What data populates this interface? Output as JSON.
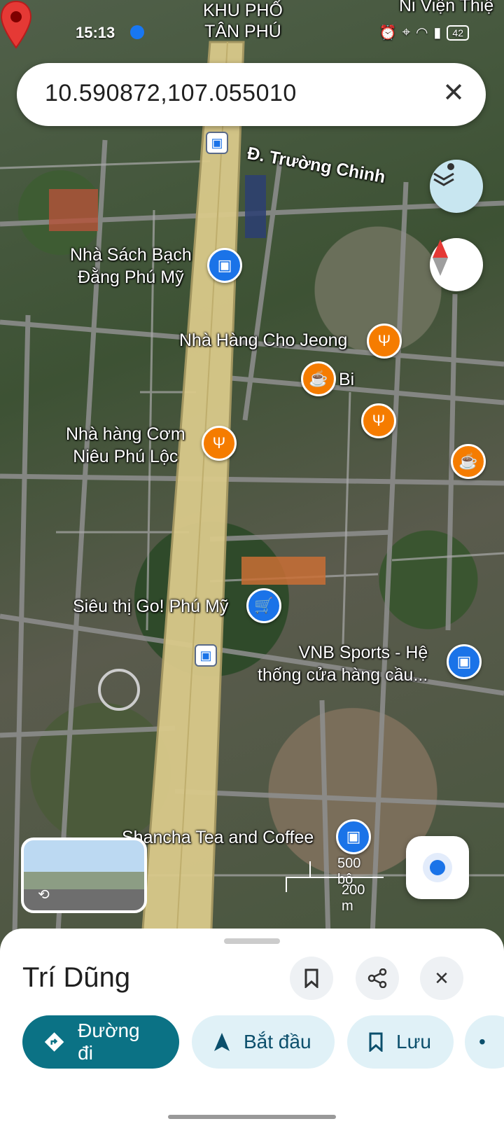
{
  "status_bar": {
    "time": "15:13",
    "battery": "42",
    "top_labels": [
      "KHU PHỐ",
      "TÂN PHÚ"
    ],
    "corner_label": "Ni Viện Thiệ"
  },
  "search": {
    "value": "10.590872,107.055010"
  },
  "map": {
    "road_label": "Đ. Trường Chinh",
    "places": [
      {
        "label": "Nhà Sách Bạch\nĐằng Phú Mỹ",
        "icon": "shopping-bag-icon",
        "color": "#1a73e8"
      },
      {
        "label": "Nhà Hàng Cho Jeong",
        "icon": "restaurant-icon",
        "color": "#f57c00"
      },
      {
        "label": "Bi",
        "icon": "cafe-icon",
        "color": "#f57c00"
      },
      {
        "label": "Nhà hàng Cơm\nNiêu Phú Lộc",
        "icon": "restaurant-icon",
        "color": "#f57c00"
      },
      {
        "label": "Siêu thị Go! Phú Mỹ",
        "icon": "cart-icon",
        "color": "#1a73e8"
      },
      {
        "label": "VNB Sports - Hệ\nthống cửa hàng cầu...",
        "icon": "shopping-bag-icon",
        "color": "#1a73e8"
      },
      {
        "label": "Shancha Tea and Coffee",
        "icon": "shopping-bag-icon",
        "color": "#1a73e8"
      }
    ],
    "scale": {
      "imperial": "500 bộ",
      "metric": "200 m"
    }
  },
  "sheet": {
    "title": "Trí Dũng",
    "actions": {
      "directions": "Đường đi",
      "start": "Bắt đầu",
      "save": "Lưu"
    }
  },
  "colors": {
    "accent": "#0b7285",
    "chip_bg": "#e0f1f7",
    "marker": "#e53935"
  }
}
